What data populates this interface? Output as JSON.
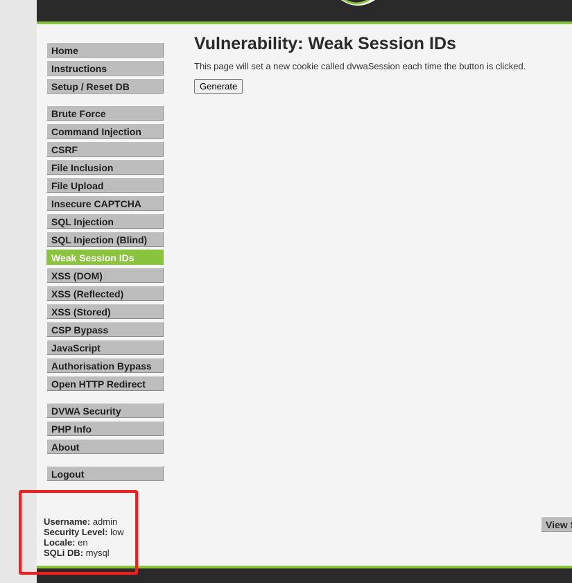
{
  "header": {
    "logo_icon": "dvwa-logo-swoosh"
  },
  "menu": {
    "groups": [
      [
        {
          "label": "Home"
        },
        {
          "label": "Instructions"
        },
        {
          "label": "Setup / Reset DB"
        }
      ],
      [
        {
          "label": "Brute Force"
        },
        {
          "label": "Command Injection"
        },
        {
          "label": "CSRF"
        },
        {
          "label": "File Inclusion"
        },
        {
          "label": "File Upload"
        },
        {
          "label": "Insecure CAPTCHA"
        },
        {
          "label": "SQL Injection"
        },
        {
          "label": "SQL Injection (Blind)"
        },
        {
          "label": "Weak Session IDs"
        },
        {
          "label": "XSS (DOM)"
        },
        {
          "label": "XSS (Reflected)"
        },
        {
          "label": "XSS (Stored)"
        },
        {
          "label": "CSP Bypass"
        },
        {
          "label": "JavaScript"
        },
        {
          "label": "Authorisation Bypass"
        },
        {
          "label": "Open HTTP Redirect"
        }
      ],
      [
        {
          "label": "DVWA Security"
        },
        {
          "label": "PHP Info"
        },
        {
          "label": "About"
        }
      ],
      [
        {
          "label": "Logout"
        }
      ]
    ],
    "active": "Weak Session IDs"
  },
  "main": {
    "title": "Vulnerability: Weak Session IDs",
    "description": "This page will set a new cookie called dvwaSession each time the button is clicked.",
    "generate_label": "Generate",
    "view_source_label": "View S"
  },
  "system_info": {
    "username_label": "Username:",
    "username": "admin",
    "security_label": "Security Level:",
    "security": "low",
    "locale_label": "Locale:",
    "locale": "en",
    "sqli_label": "SQLi DB:",
    "sqli": "mysql"
  },
  "colors": {
    "accent": "#8ac43f",
    "header_bg": "#2a2a2a",
    "menu_bg": "#bdbdbd",
    "highlight": "#ff1a1a"
  }
}
